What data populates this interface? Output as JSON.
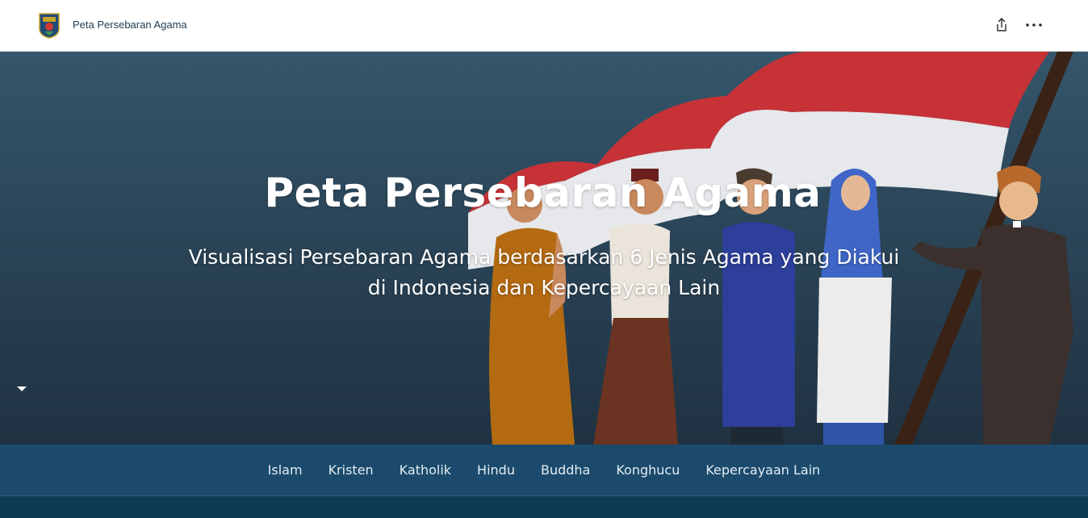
{
  "header": {
    "title": "Peta Persebaran Agama",
    "logo_icon": "government-emblem-icon",
    "share_icon": "share-icon",
    "more_icon": "more-options-icon"
  },
  "hero": {
    "title": "Peta Persebaran Agama",
    "subtitle": "Visualisasi Persebaran Agama berdasarkan 6 Jenis Agama yang Diakui di Indonesia dan Kepercayaan Lain",
    "scroll_icon": "caret-down-icon",
    "colors": {
      "background_top": "#34566b",
      "background_bottom": "#1f3242",
      "flag_red": "#c63236",
      "flag_white": "#e9ebee"
    }
  },
  "nav": {
    "items": [
      {
        "label": "Islam"
      },
      {
        "label": "Kristen"
      },
      {
        "label": "Katholik"
      },
      {
        "label": "Hindu"
      },
      {
        "label": "Buddha"
      },
      {
        "label": "Konghucu"
      },
      {
        "label": "Kepercayaan Lain"
      }
    ],
    "colors": {
      "background": "#1b4a6c",
      "text": "#e3ecf2"
    }
  }
}
